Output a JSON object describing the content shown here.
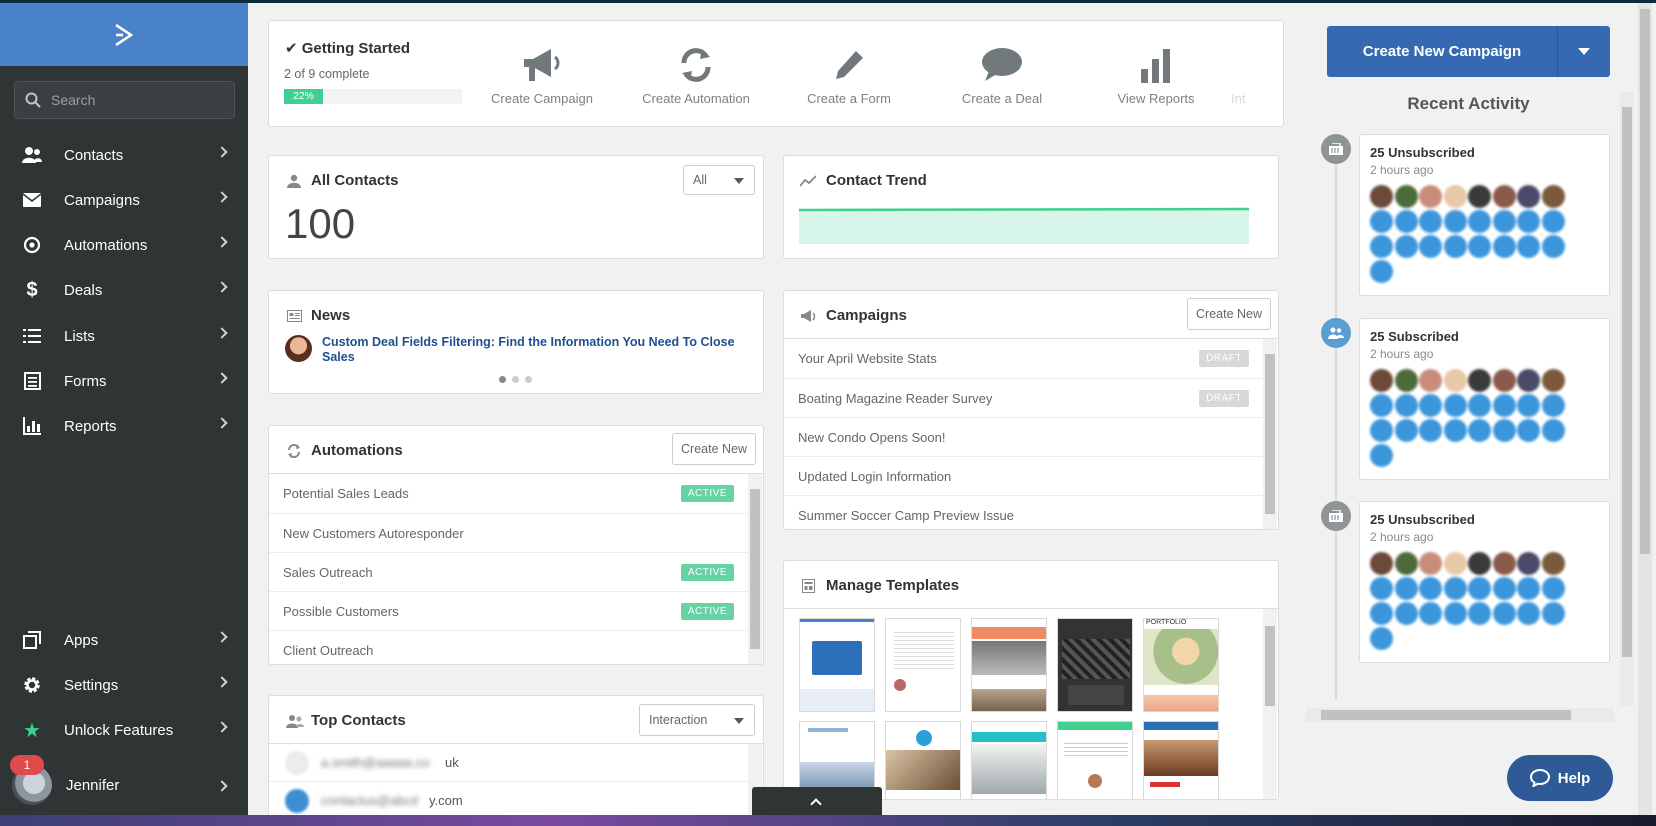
{
  "sidebar": {
    "search_placeholder": "Search",
    "items": [
      {
        "label": "Contacts",
        "icon": "contacts-icon"
      },
      {
        "label": "Campaigns",
        "icon": "envelope-icon"
      },
      {
        "label": "Automations",
        "icon": "automation-icon"
      },
      {
        "label": "Deals",
        "icon": "dollar-icon"
      },
      {
        "label": "Lists",
        "icon": "list-icon"
      },
      {
        "label": "Forms",
        "icon": "form-icon"
      },
      {
        "label": "Reports",
        "icon": "bar-chart-icon"
      }
    ],
    "bottom_items": [
      {
        "label": "Apps",
        "icon": "apps-icon"
      },
      {
        "label": "Settings",
        "icon": "gear-icon"
      },
      {
        "label": "Unlock Features",
        "icon": "star-icon"
      }
    ],
    "user": {
      "name": "Jennifer",
      "notification_count": "1"
    }
  },
  "getting_started": {
    "title": "Getting Started",
    "progress_text": "2 of 9 complete",
    "progress_label": "22%",
    "progress_fraction": 0.22,
    "actions": [
      "Create Campaign",
      "Create Automation",
      "Create a Form",
      "Create a Deal",
      "View Reports",
      "Int"
    ]
  },
  "all_contacts": {
    "title": "All Contacts",
    "filter": "All",
    "count": "100"
  },
  "contact_trend": {
    "title": "Contact Trend"
  },
  "news": {
    "title": "News",
    "headline": "Custom Deal Fields Filtering: Find the Information You Need To Close Sales"
  },
  "campaigns": {
    "title": "Campaigns",
    "create_label": "Create New",
    "rows": [
      {
        "name": "Your April Website Stats",
        "status": "DRAFT"
      },
      {
        "name": "Boating Magazine Reader Survey",
        "status": "DRAFT"
      },
      {
        "name": "New Condo Opens Soon!",
        "status": ""
      },
      {
        "name": "Updated Login Information",
        "status": ""
      },
      {
        "name": "Summer Soccer Camp Preview Issue",
        "status": ""
      }
    ]
  },
  "automations": {
    "title": "Automations",
    "create_label": "Create New",
    "rows": [
      {
        "name": "Potential Sales Leads",
        "status": "ACTIVE"
      },
      {
        "name": "New Customers Autoresponder",
        "status": ""
      },
      {
        "name": "Sales Outreach",
        "status": "ACTIVE"
      },
      {
        "name": "Possible Customers",
        "status": "ACTIVE"
      },
      {
        "name": "Client Outreach",
        "status": ""
      }
    ]
  },
  "manage_templates": {
    "title": "Manage Templates",
    "template_label": "PORTFOLIO"
  },
  "top_contacts": {
    "title": "Top Contacts",
    "sort": "Interaction",
    "rows": [
      {
        "email_blurred": "a.smith@aaaaa.co",
        "email_tail": "uk"
      },
      {
        "email_blurred": "contactus@abcd",
        "email_tail": "y.com"
      }
    ]
  },
  "right": {
    "cta_label": "Create New Campaign",
    "recent_title": "Recent Activity",
    "activities": [
      {
        "title": "25 Unsubscribed",
        "time": "2 hours ago",
        "icon": "unsubscribe-icon"
      },
      {
        "title": "25 Subscribed",
        "time": "2 hours ago",
        "icon": "subscribe-icon"
      },
      {
        "title": "25 Unsubscribed",
        "time": "2 hours ago",
        "icon": "unsubscribe-icon"
      }
    ],
    "help_label": "Help"
  },
  "colors": {
    "brand_blue": "#356ab3",
    "sidebar_bg": "#2f3435",
    "active_green": "#67d2a4",
    "draft_gray": "#d8d8d8"
  }
}
